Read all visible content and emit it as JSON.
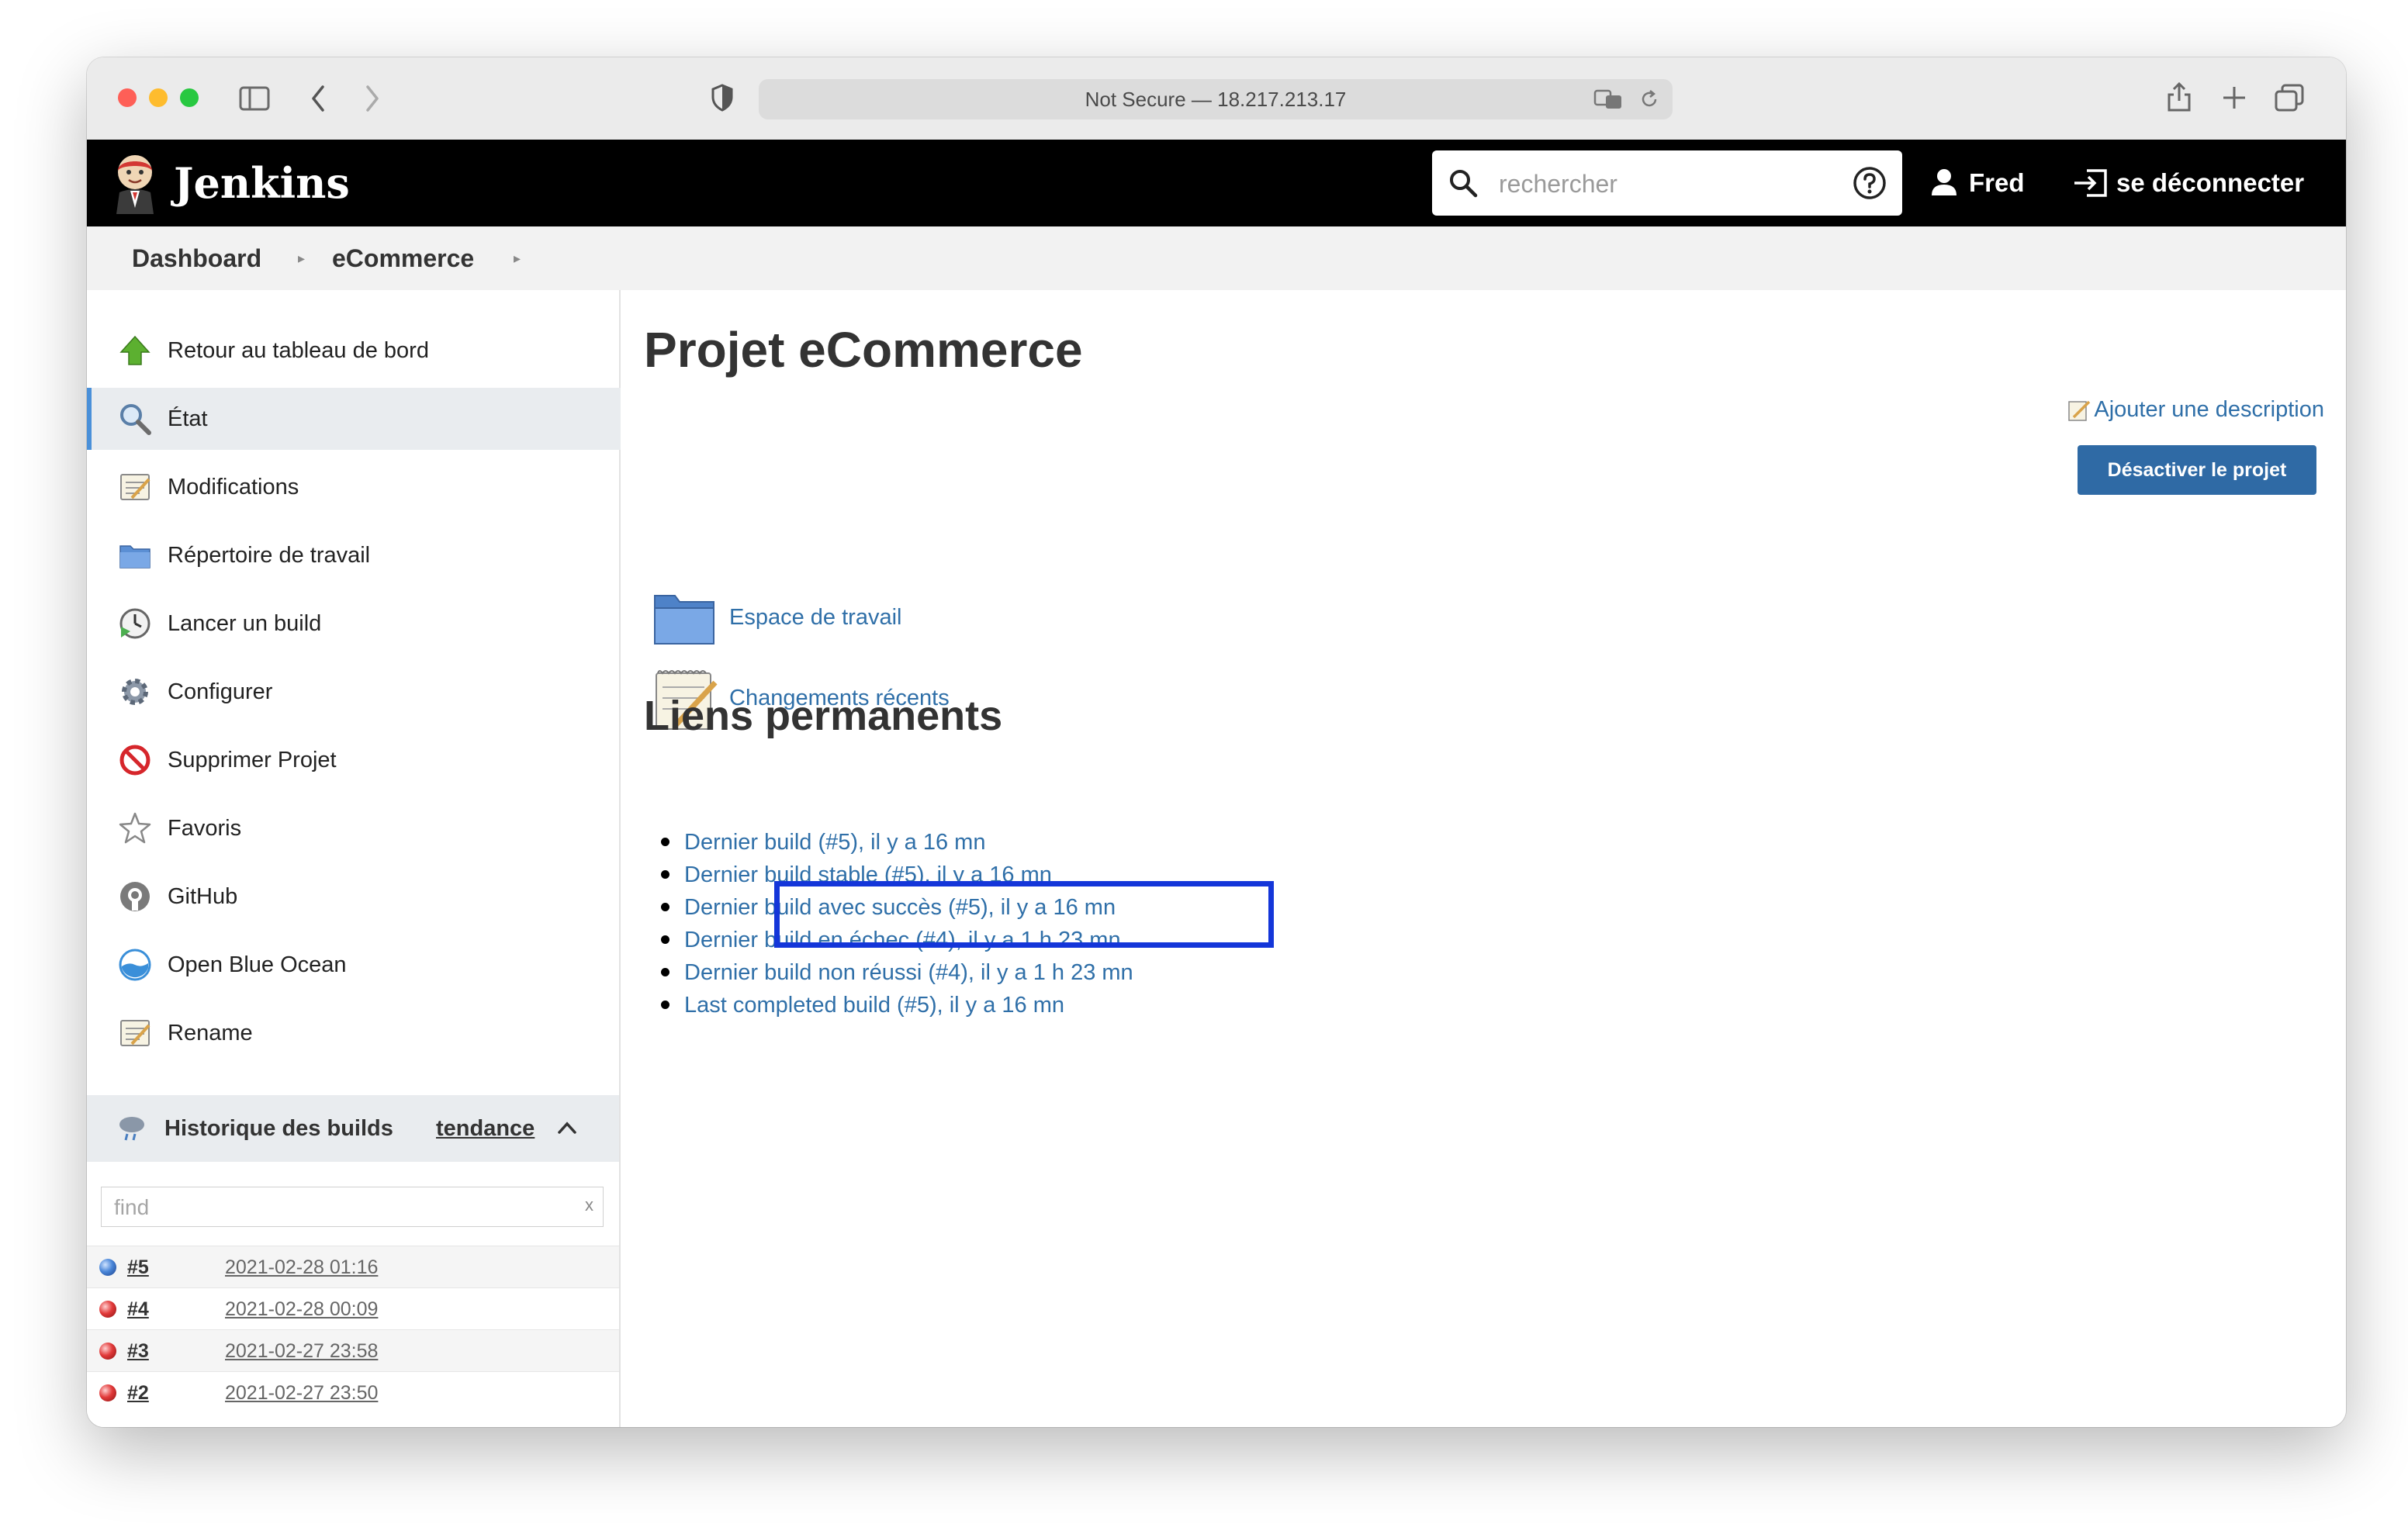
{
  "browser": {
    "address": "Not Secure — 18.217.213.17"
  },
  "header": {
    "brand": "Jenkins",
    "search_placeholder": "rechercher",
    "user": "Fred",
    "logout": "se déconnecter"
  },
  "breadcrumb": [
    "Dashboard",
    "eCommerce"
  ],
  "sidebar": {
    "items": [
      {
        "label": "Retour au tableau de bord",
        "icon": "up-arrow-icon"
      },
      {
        "label": "État",
        "icon": "magnifier-icon"
      },
      {
        "label": "Modifications",
        "icon": "notepad-icon"
      },
      {
        "label": "Répertoire de travail",
        "icon": "folder-icon"
      },
      {
        "label": "Lancer un build",
        "icon": "clock-play-icon"
      },
      {
        "label": "Configurer",
        "icon": "gear-icon"
      },
      {
        "label": "Supprimer Projet",
        "icon": "no-entry-icon"
      },
      {
        "label": "Favoris",
        "icon": "star-icon"
      },
      {
        "label": "GitHub",
        "icon": "github-icon"
      },
      {
        "label": "Open Blue Ocean",
        "icon": "blue-ocean-icon"
      },
      {
        "label": "Rename",
        "icon": "notepad-icon"
      }
    ],
    "active_index": 1
  },
  "build_history": {
    "title": "Historique des builds",
    "trend": "tendance",
    "find_placeholder": "find",
    "find_clear": "x",
    "builds": [
      {
        "number": "#5",
        "date": "2021-02-28 01:16",
        "status": "blue"
      },
      {
        "number": "#4",
        "date": "2021-02-28 00:09",
        "status": "red"
      },
      {
        "number": "#3",
        "date": "2021-02-27 23:58",
        "status": "red"
      },
      {
        "number": "#2",
        "date": "2021-02-27 23:50",
        "status": "red"
      }
    ]
  },
  "main": {
    "title": "Projet eCommerce",
    "add_description": "Ajouter une description",
    "disable_button": "Désactiver le projet",
    "links": [
      {
        "label": "Espace de travail",
        "icon": "folder-icon"
      },
      {
        "label": "Changements récents",
        "icon": "notepad-icon"
      }
    ],
    "permalinks_title": "Liens permanents",
    "permalinks": [
      "Dernier build (#5), il y a 16 mn",
      "Dernier build stable (#5), il y a 16 mn",
      "Dernier build avec succès (#5), il y a 16 mn",
      "Dernier build en échec (#4), il y a 1 h 23 mn",
      "Dernier build non réussi (#4), il y a 1 h 23 mn",
      "Last completed build (#5), il y a 16 mn"
    ]
  },
  "colors": {
    "link": "#2f6fa8",
    "header_bg": "#000000",
    "button_bg": "#2f6aa5",
    "highlight_box": "#1436d9"
  }
}
